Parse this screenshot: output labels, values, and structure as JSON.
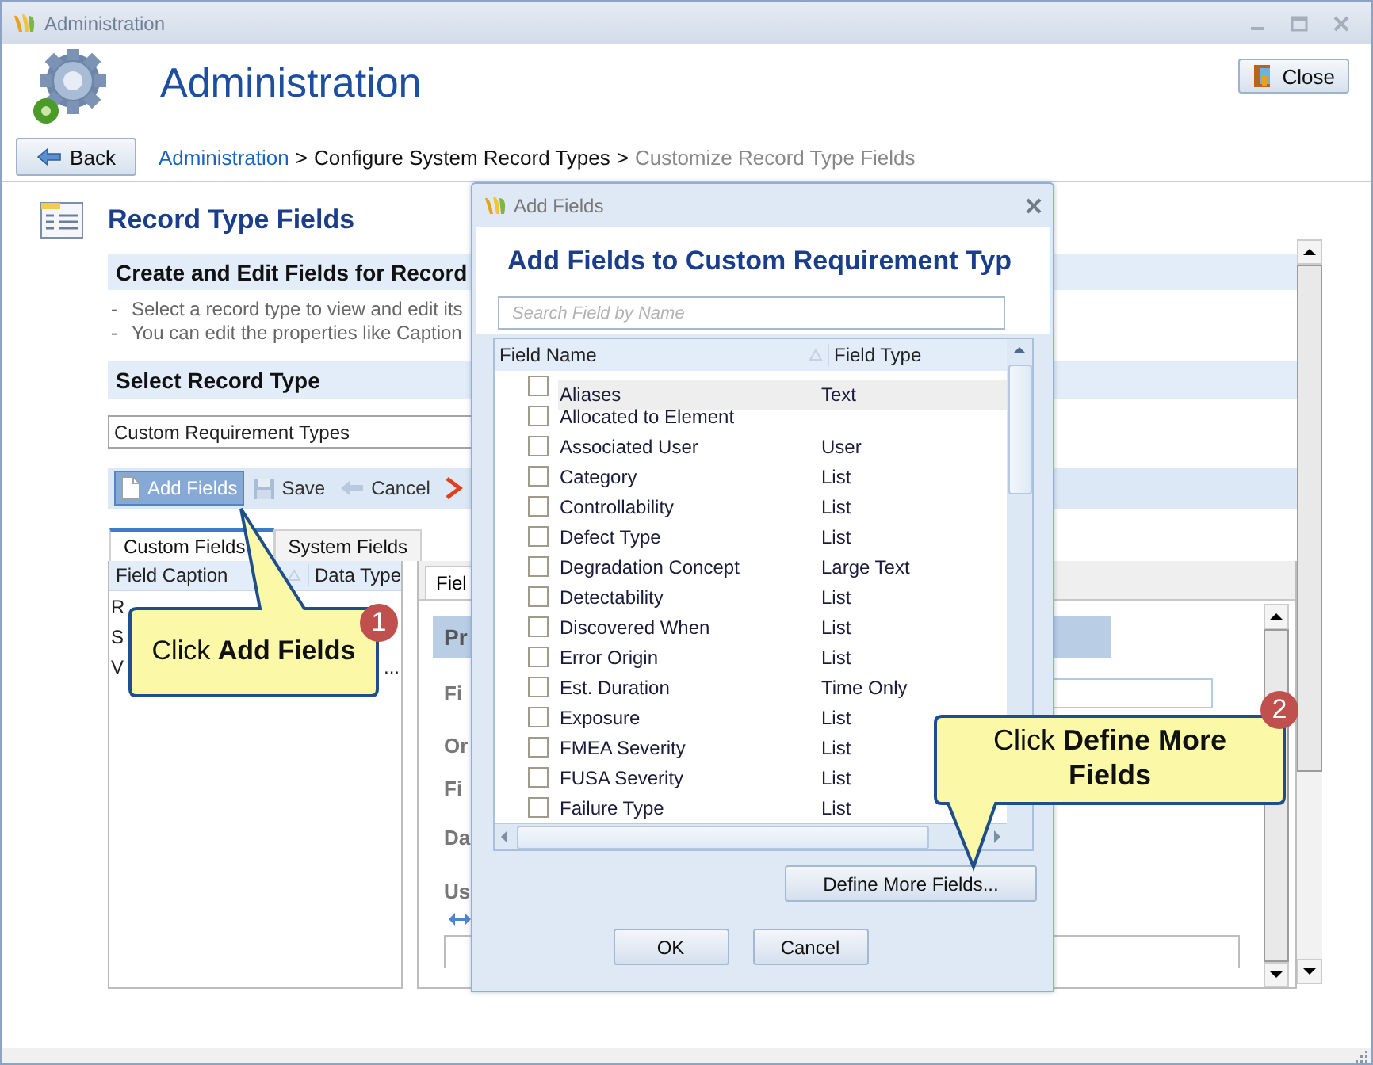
{
  "window": {
    "title": "Administration"
  },
  "header": {
    "title": "Administration",
    "close_button": "Close",
    "back_button": "Back",
    "breadcrumb": [
      {
        "text": "Administration",
        "kind": "link"
      },
      {
        "text": ">",
        "kind": "separator"
      },
      {
        "text": "Configure System Record Types",
        "kind": "item"
      },
      {
        "text": ">",
        "kind": "separator"
      },
      {
        "text": "Customize Record Type Fields",
        "kind": "current"
      }
    ]
  },
  "panel": {
    "title": "Record Type Fields",
    "subtitle": "Create and Edit Fields for Record",
    "notes": [
      {
        "bullet": "-",
        "text": "Select a record type to view and edit its"
      },
      {
        "bullet": "-",
        "text": "You can edit the properties like Caption"
      }
    ],
    "select_label": "Select Record Type",
    "record_type": "Custom Requirement Types"
  },
  "toolbar": [
    {
      "kind": "add",
      "label": "Add Fields",
      "selected": true
    },
    {
      "kind": "save",
      "label": "Save",
      "selected": false
    },
    {
      "kind": "cancel",
      "label": "Cancel",
      "selected": false
    },
    {
      "kind": "delete",
      "selected": false
    }
  ],
  "tabs": [
    {
      "label": "Custom Fields",
      "selected": true
    },
    {
      "label": "System Fields",
      "selected": false
    }
  ],
  "field_list": {
    "columns": [
      "Field Caption",
      "Data Type"
    ],
    "rows": [
      {
        "text": "R"
      },
      {
        "text": "S"
      },
      {
        "text": "V",
        "more": "..."
      }
    ]
  },
  "properties": {
    "tab": "Fiel",
    "section": "Pr",
    "labels": [
      "Fi",
      "Or",
      "Fi",
      "Da",
      "Us"
    ]
  },
  "dialog": {
    "title": "Add Fields",
    "heading": "Add Fields to Custom Requirement Typ",
    "search": {
      "placeholder": "Search Field by Name"
    },
    "columns": [
      "Field Name",
      "Field Type"
    ],
    "rows": [
      {
        "name": "Aliases",
        "type": "Text",
        "checked": false,
        "selected": true
      },
      {
        "name": "Allocated to Element",
        "checked": false,
        "selected": false
      },
      {
        "name": "Associated User",
        "type": "User",
        "checked": false,
        "selected": false
      },
      {
        "name": "Category",
        "type": "List",
        "checked": false,
        "selected": false
      },
      {
        "name": "Controllability",
        "type": "List",
        "checked": false,
        "selected": false
      },
      {
        "name": "Defect Type",
        "type": "List",
        "checked": false,
        "selected": false
      },
      {
        "name": "Degradation Concept",
        "type": "Large Text",
        "checked": false,
        "selected": false
      },
      {
        "name": "Detectability",
        "type": "List",
        "checked": false,
        "selected": false
      },
      {
        "name": "Discovered When",
        "type": "List",
        "checked": false,
        "selected": false
      },
      {
        "name": "Error Origin",
        "type": "List",
        "checked": false,
        "selected": false
      },
      {
        "name": "Est. Duration",
        "type": "Time Only",
        "checked": false,
        "selected": false
      },
      {
        "name": "Exposure",
        "type": "List",
        "checked": false,
        "selected": false
      },
      {
        "name": "FMEA Severity",
        "type": "List",
        "checked": false,
        "selected": false
      },
      {
        "name": "FUSA Severity",
        "type": "List",
        "checked": false,
        "selected": false
      },
      {
        "name": "Failure Type",
        "type": "List",
        "checked": false,
        "selected": false
      }
    ],
    "define_button": "Define More Fields...",
    "buttons": [
      "OK",
      "Cancel"
    ]
  },
  "callouts": [
    {
      "text": "Click **Add Fields**",
      "step": "1"
    },
    {
      "text": "Click **Define More Fields**",
      "step": "2"
    }
  ]
}
